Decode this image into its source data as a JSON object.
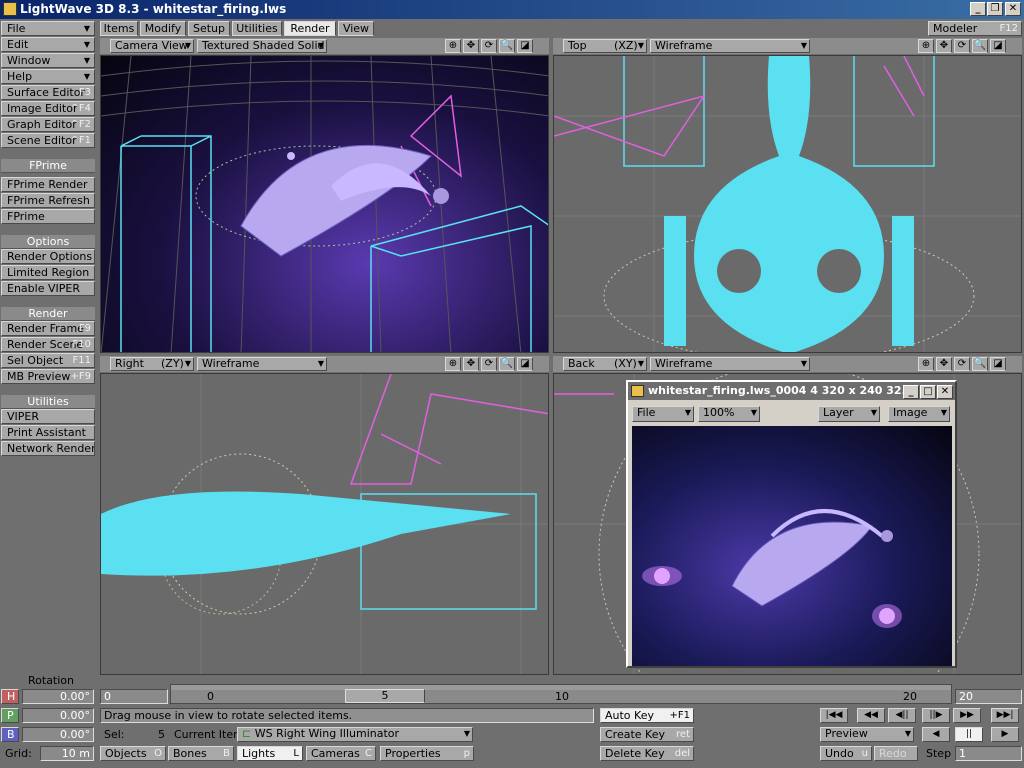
{
  "window": {
    "title": "LightWave 3D 8.3 - whitestar_firing.lws"
  },
  "tabs": [
    {
      "label": "Items"
    },
    {
      "label": "Modify"
    },
    {
      "label": "Setup"
    },
    {
      "label": "Utilities"
    },
    {
      "label": "Render",
      "selected": true
    },
    {
      "label": "View"
    }
  ],
  "modeler": {
    "label": "Modeler",
    "shortcut": "F12"
  },
  "left_menu": {
    "top": [
      {
        "label": "File"
      },
      {
        "label": "Edit"
      },
      {
        "label": "Window"
      },
      {
        "label": "Help"
      }
    ],
    "editors": [
      {
        "label": "Surface Editor",
        "shortcut": "F3"
      },
      {
        "label": "Image Editor",
        "shortcut": "^F4"
      },
      {
        "label": "Graph Editor",
        "shortcut": "^F2"
      },
      {
        "label": "Scene Editor",
        "shortcut": "^F1"
      }
    ],
    "fprime_header": "FPrime",
    "fprime": [
      {
        "label": "FPrime Render"
      },
      {
        "label": "FPrime Refresh"
      },
      {
        "label": "FPrime"
      }
    ],
    "options_header": "Options",
    "options": [
      {
        "label": "Render Options"
      },
      {
        "label": "Limited Region"
      },
      {
        "label": "Enable VIPER"
      }
    ],
    "render_header": "Render",
    "render": [
      {
        "label": "Render Frame",
        "shortcut": "F9"
      },
      {
        "label": "Render Scene",
        "shortcut": "F10"
      },
      {
        "label": "Sel Object",
        "shortcut": "F11"
      },
      {
        "label": "MB Preview",
        "shortcut": "+F9"
      }
    ],
    "utilities_header": "Utilities",
    "utilities": [
      {
        "label": "VIPER"
      },
      {
        "label": "Print Assistant"
      },
      {
        "label": "Network Render"
      }
    ]
  },
  "viewports": {
    "top_left": {
      "view": "Camera View",
      "mode": "Textured Shaded Solid"
    },
    "top_right": {
      "view": "Top",
      "axis": "(XZ)",
      "mode": "Wireframe"
    },
    "bottom_left": {
      "view": "Right",
      "axis": "(ZY)",
      "mode": "Wireframe"
    },
    "bottom_right": {
      "view": "Back",
      "axis": "(XY)",
      "mode": "Wireframe"
    }
  },
  "image_window": {
    "title": "whitestar_firing.lws_0004 4  320 x 240 32...",
    "file": "File",
    "zoom": "100%",
    "layer": "Layer",
    "image": "Image"
  },
  "bottom": {
    "rotation_label": "Rotation",
    "h_label": "H",
    "p_label": "P",
    "b_label": "B",
    "h_value": "0.00°",
    "p_value": "0.00°",
    "b_value": "0.00°",
    "grid_label": "Grid:",
    "grid_value": "10 m",
    "frame_start": "0",
    "frame_end": "20",
    "current_frame": "5",
    "ticks": [
      "0",
      "10",
      "20"
    ],
    "status": "Drag mouse in view to rotate selected items.",
    "sel_label": "Sel:",
    "sel_value": "5",
    "current_item_label": "Current Item",
    "current_item": "WS Right Wing Illuminator",
    "objects": "Objects",
    "objects_sc": "O",
    "bones": "Bones",
    "bones_sc": "B",
    "lights": "Lights",
    "lights_sc": "L",
    "cameras": "Cameras",
    "cameras_sc": "C",
    "properties": "Properties",
    "properties_sc": "p",
    "auto_key": "Auto Key",
    "auto_key_sc": "+F1",
    "create_key": "Create Key",
    "create_key_sc": "ret",
    "delete_key": "Delete Key",
    "delete_key_sc": "del",
    "preview": "Preview",
    "undo": "Undo",
    "undo_sc": "u",
    "redo": "Redo",
    "step_label": "Step",
    "step_value": "1"
  },
  "colors": {
    "wire_cyan": "#5ae0f0",
    "wire_magenta": "#e060e0",
    "title_blue": "#0a246a"
  }
}
